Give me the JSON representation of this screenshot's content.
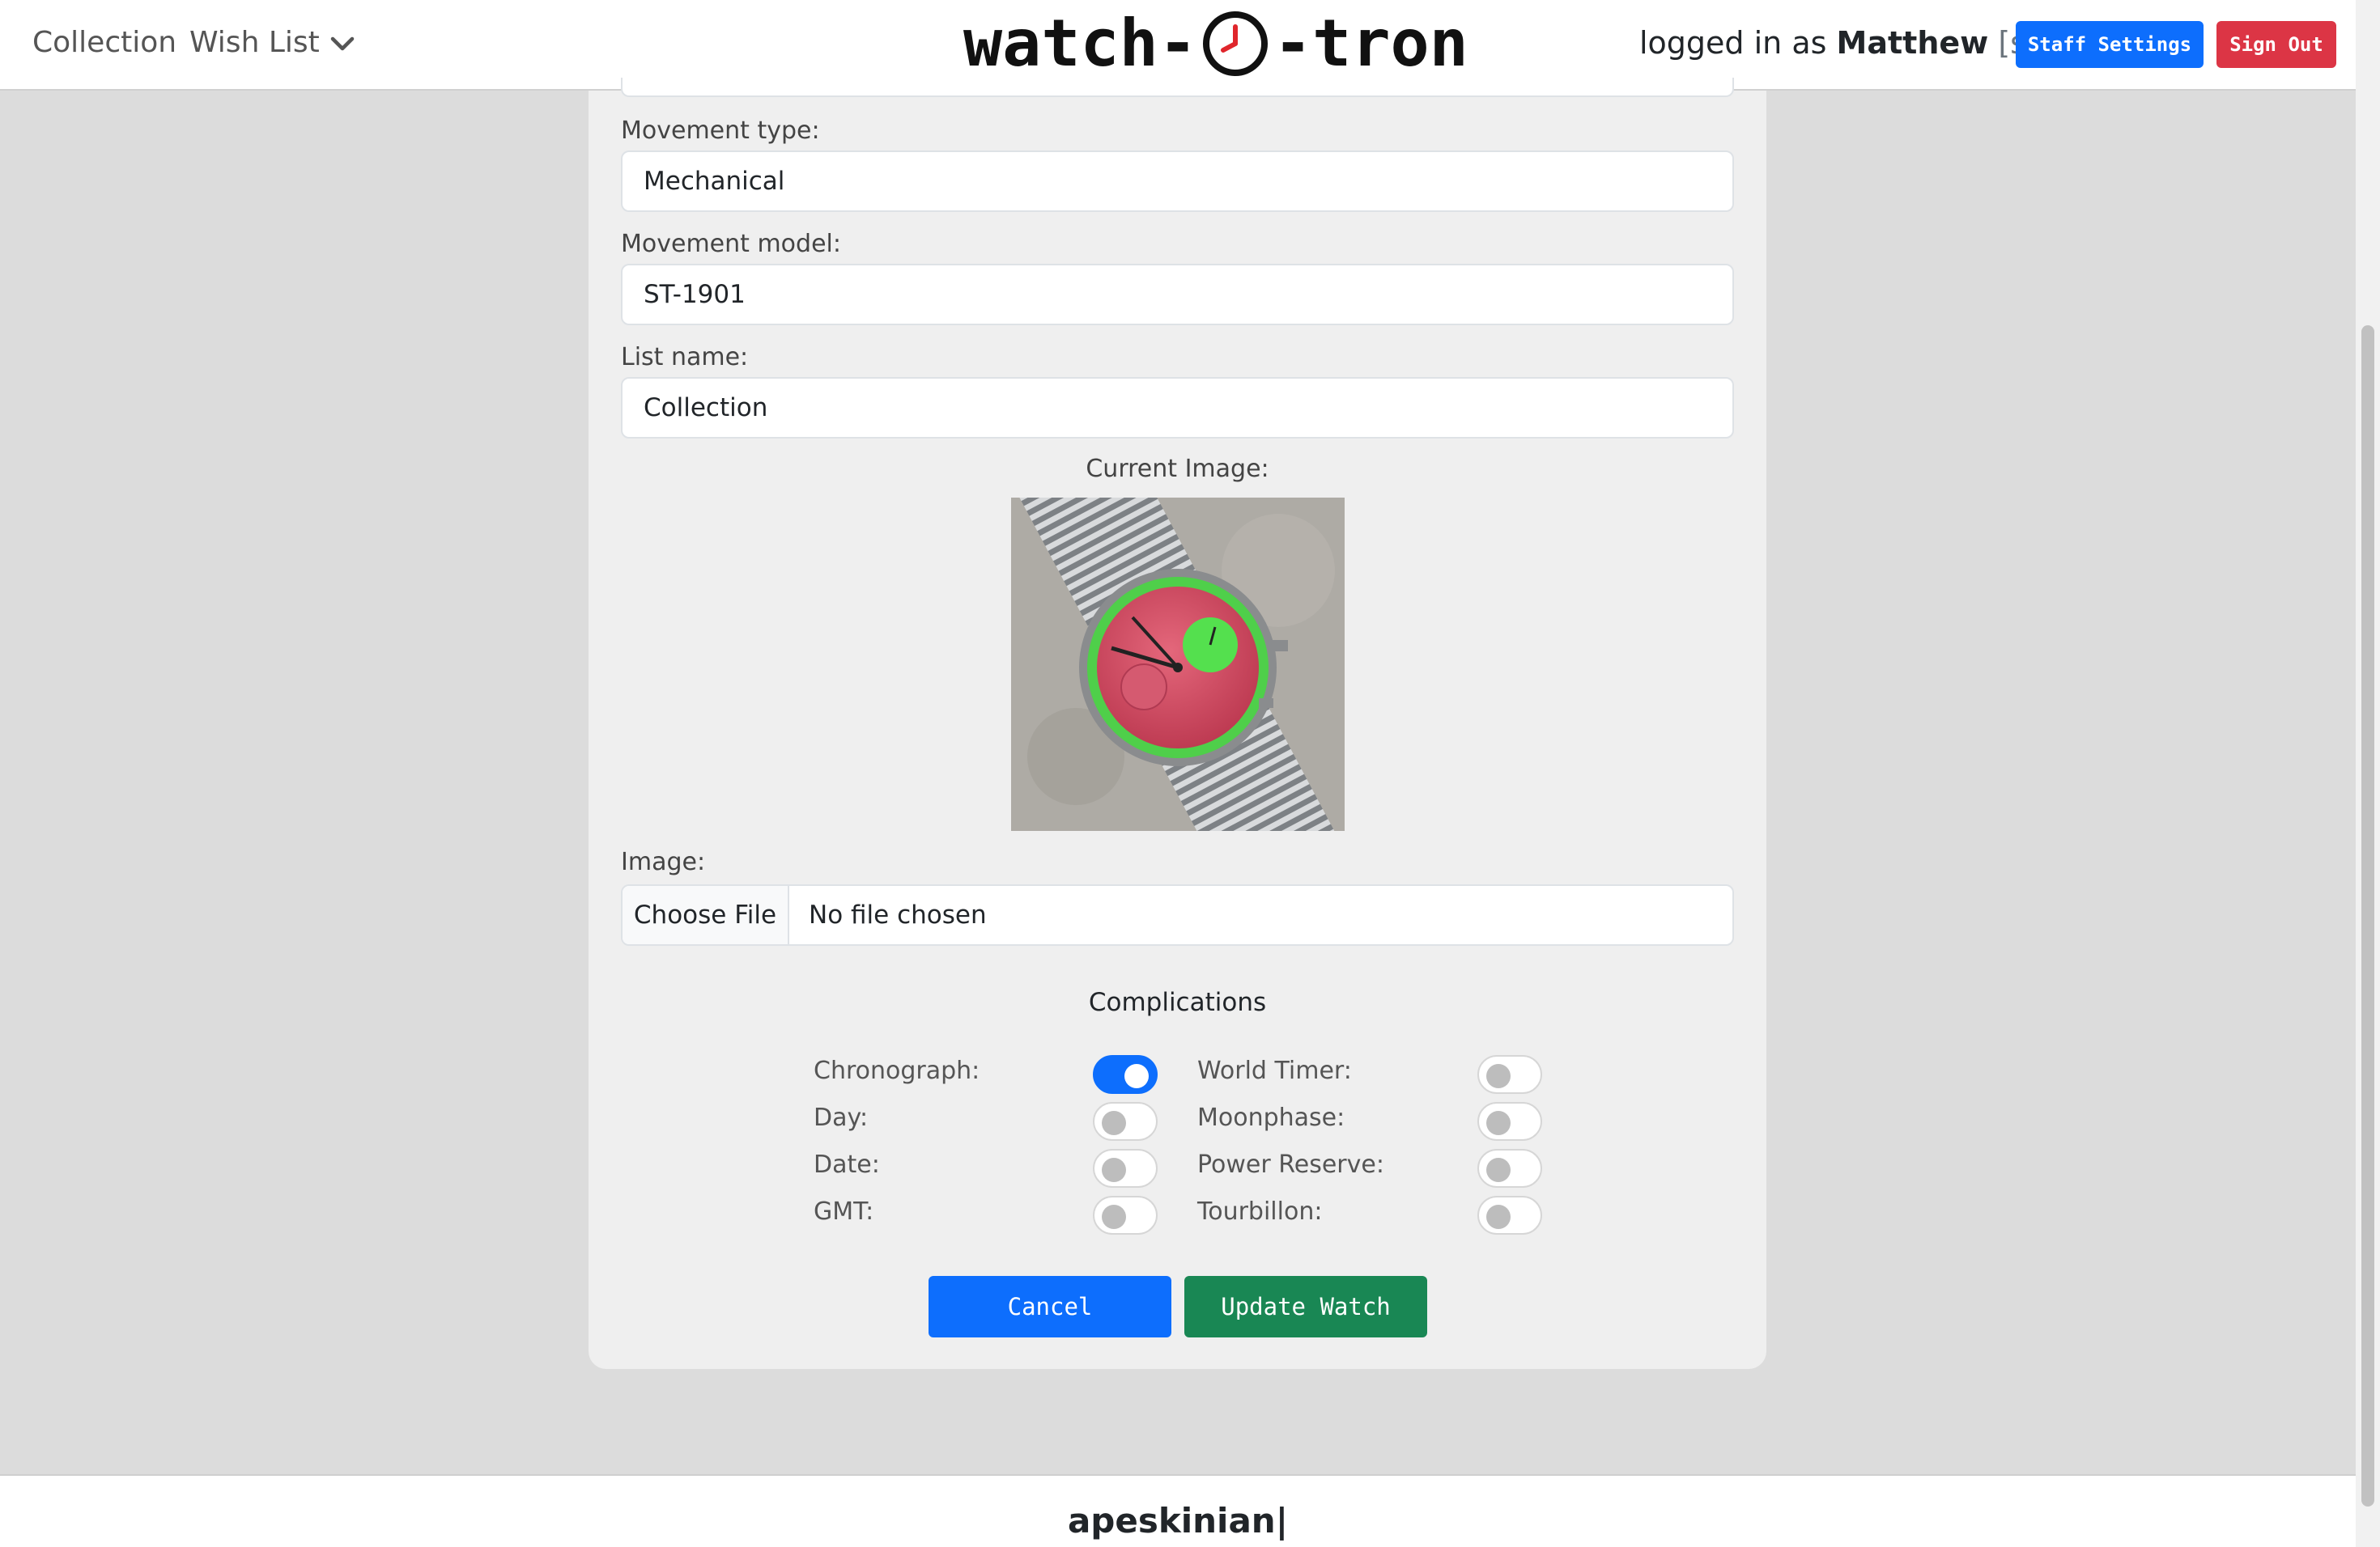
{
  "nav": {
    "links": [
      "Collection",
      "Wish List"
    ],
    "dropdown_icon": "chevron-down-icon",
    "brand_left": "watch-",
    "brand_right": "-tron",
    "brand_icon": "clock-icon",
    "login_prefix": "logged in as",
    "user": "Matthew",
    "role": "[staff]",
    "staff_settings_label": "Staff Settings",
    "sign_out_label": "Sign Out"
  },
  "form": {
    "movement_type_label": "Movement type:",
    "movement_type_value": "Mechanical",
    "movement_model_label": "Movement model:",
    "movement_model_value": "ST-1901",
    "list_name_label": "List name:",
    "list_name_value": "Collection",
    "current_image_label": "Current Image:",
    "image_label": "Image:",
    "choose_file_label": "Choose File",
    "file_status": "No file chosen"
  },
  "complications": {
    "heading": "Complications",
    "left": [
      {
        "label": "Chronograph:",
        "checked": true
      },
      {
        "label": "Day:",
        "checked": false
      },
      {
        "label": "Date:",
        "checked": false
      },
      {
        "label": "GMT:",
        "checked": false
      }
    ],
    "right": [
      {
        "label": "World Timer:",
        "checked": false
      },
      {
        "label": "Moonphase:",
        "checked": false
      },
      {
        "label": "Power Reserve:",
        "checked": false
      },
      {
        "label": "Tourbillon:",
        "checked": false
      }
    ]
  },
  "actions": {
    "cancel_label": "Cancel",
    "update_label": "Update Watch"
  },
  "footer": {
    "text": "apeskinian|"
  },
  "colors": {
    "primary": "#0d6efd",
    "danger": "#dc3545",
    "success": "#198754",
    "brand_clock_hand": "#e0262c"
  }
}
